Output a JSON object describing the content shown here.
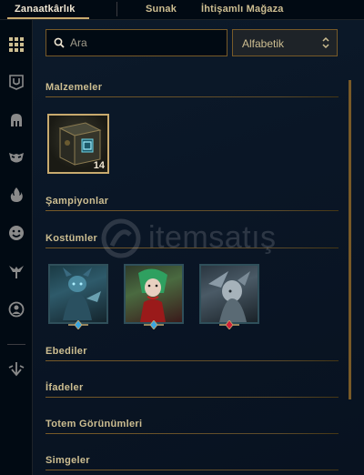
{
  "tabs": [
    {
      "label": "Zanaatkârlık",
      "active": true
    },
    {
      "label": "Sunak",
      "active": false
    },
    {
      "label": "İhtişamlı Mağaza",
      "active": false
    }
  ],
  "sidebar": {
    "icons": [
      "grid-icon",
      "loot-icon",
      "helmet-icon",
      "mask-icon",
      "flame-icon",
      "emote-icon",
      "ward-icon",
      "profile-icon",
      "arrow-down-icon"
    ]
  },
  "search": {
    "placeholder": "Ara"
  },
  "sort": {
    "selected": "Alfabetik"
  },
  "sections": {
    "materials": "Malzemeler",
    "champions": "Şampiyonlar",
    "skins": "Kostümler",
    "eternals": "Ebediler",
    "emotes": "İfadeler",
    "totems": "Totem Görünümleri",
    "icons": "Simgeler"
  },
  "chest": {
    "count": "14"
  },
  "skins": [
    {
      "gem": "blue"
    },
    {
      "gem": "blue"
    },
    {
      "gem": "red"
    }
  ],
  "watermark": "itemsatış",
  "colors": {
    "accent": "#c8aa6e",
    "background": "#0a1420",
    "text": "#cdbe91"
  }
}
